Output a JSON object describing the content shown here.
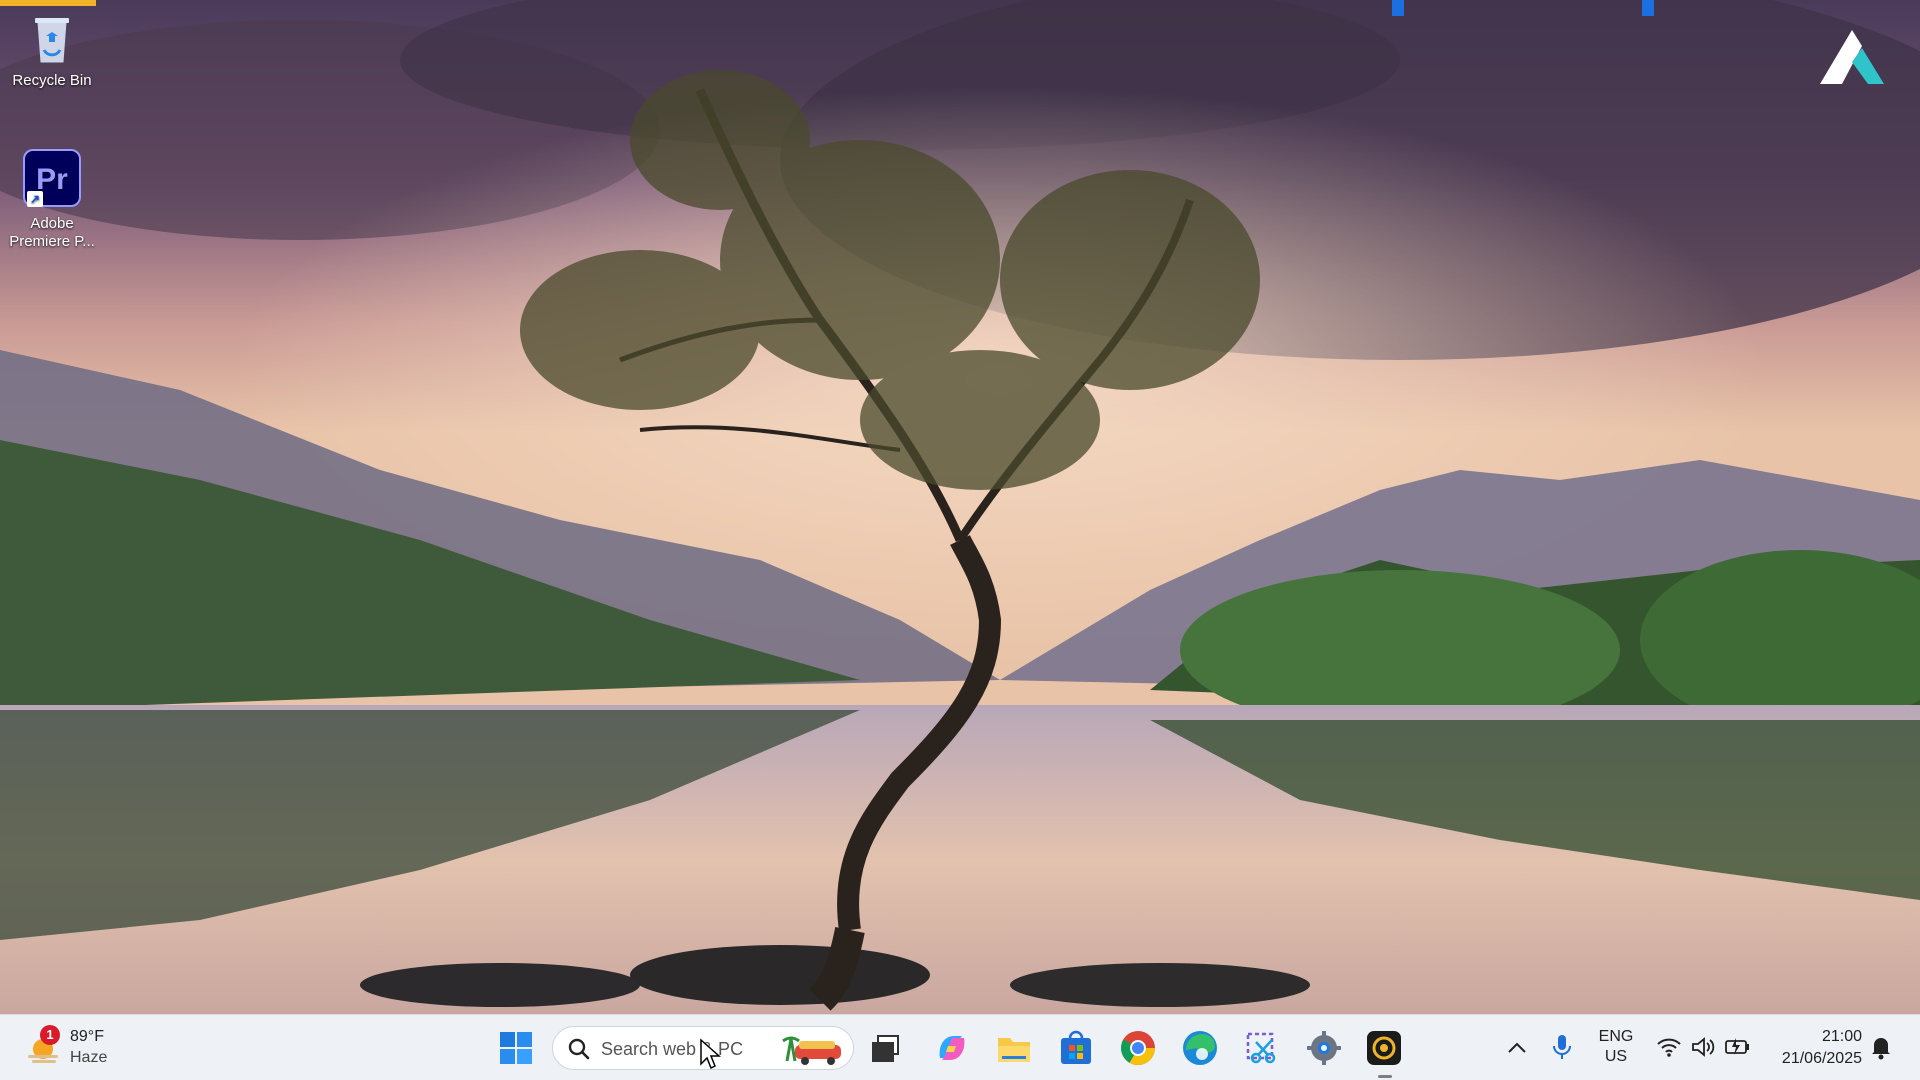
{
  "desktop": {
    "icons": [
      {
        "label": "Recycle Bin",
        "icon": "recycle-bin-icon"
      },
      {
        "label": "Adobe Premiere P...",
        "icon": "adobe-premiere-pro-icon",
        "tile_text": "Pr"
      }
    ],
    "watermark_icon": "atreus-logo-icon"
  },
  "taskbar": {
    "weather": {
      "badge": "1",
      "temp": "89°F",
      "condition": "Haze",
      "icon": "sun-haze-icon"
    },
    "start_icon": "windows-start-icon",
    "search": {
      "placeholder": "Search web & PC",
      "icon": "search-icon"
    },
    "pinned": [
      "task-view-icon",
      "copilot-icon",
      "file-explorer-icon",
      "microsoft-store-icon",
      "chrome-icon",
      "edge-icon",
      "snipping-tool-icon",
      "settings-icon",
      "camera-recorder-icon"
    ],
    "tray": {
      "language_top": "ENG",
      "language_bottom": "US",
      "time": "21:00",
      "date": "21/06/2025"
    }
  },
  "colors": {
    "taskbar_bg": "#eef1f6",
    "accent": "#0078d4",
    "premiere_bg": "#00005b",
    "premiere_fg": "#9999ff"
  }
}
